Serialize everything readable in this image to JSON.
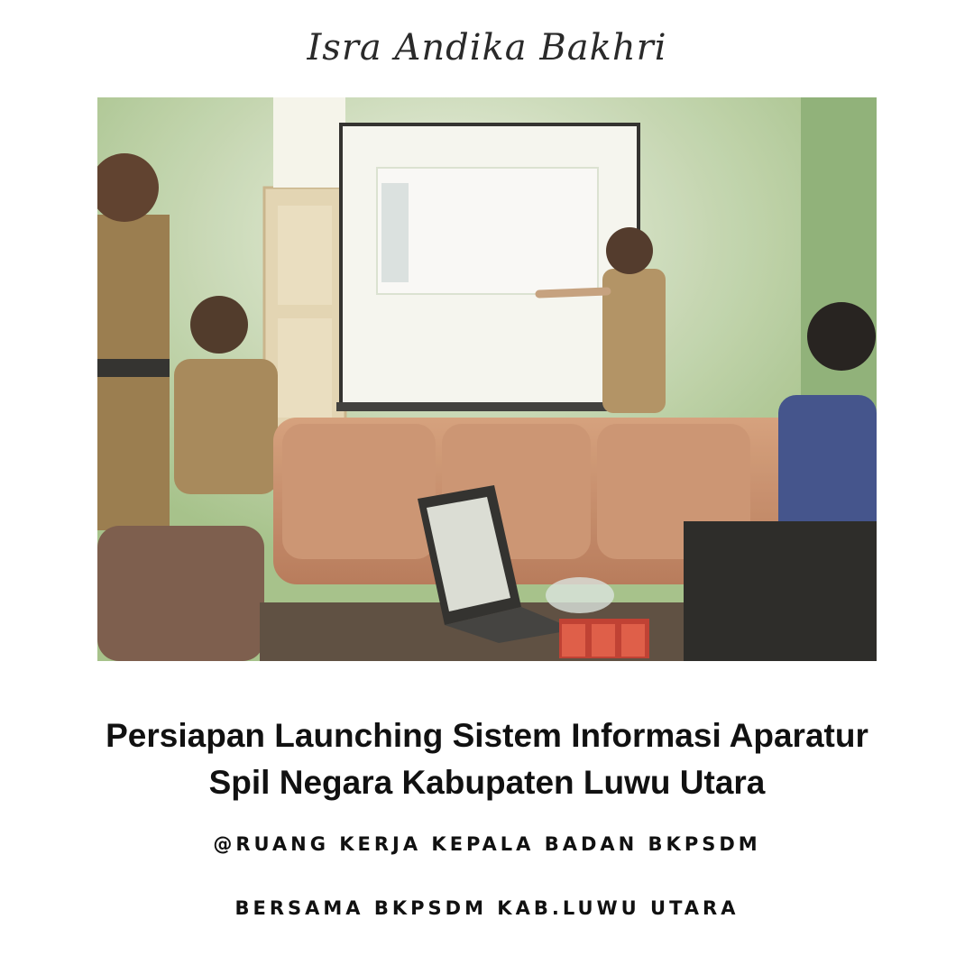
{
  "author": "Isra Andika Bakhri",
  "photo": {
    "description_icon": "meeting-photo"
  },
  "title": {
    "line1": "Persiapan Launching Sistem Informasi Aparatur",
    "line2": "Spil Negara Kabupaten Luwu Utara"
  },
  "location": "@RUANG KERJA KEPALA BADAN BKPSDM",
  "organizer": "BERSAMA BKPSDM KAB.LUWU UTARA"
}
